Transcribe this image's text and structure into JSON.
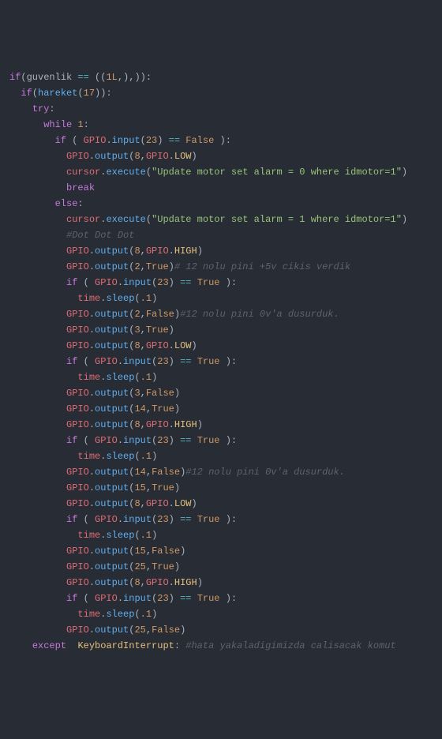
{
  "code": {
    "l01": {
      "guvenlik": "guvenlik",
      "if": "if",
      "eq": "==",
      "one": "1L",
      "colon": ":"
    },
    "l02": {
      "if": "if",
      "hareket": "hareket",
      "n": "17",
      "colon": ":"
    },
    "l03": {
      "try": "try",
      "colon": ":"
    },
    "l04": {
      "while": "while",
      "one": "1",
      "colon": ":"
    },
    "l05": {
      "if": "if",
      "gpio": "GPIO",
      "input": "input",
      "n": "23",
      "eq": "==",
      "false": "False",
      "colon": ":"
    },
    "l06": {
      "gpio": "GPIO",
      "output": "output",
      "n": "8",
      "gpio2": "GPIO",
      "low": "LOW"
    },
    "l07": {
      "cursor": "cursor",
      "execute": "execute",
      "str": "\"Update motor set alarm = 0 where idmotor=1\""
    },
    "l08": {
      "break": "break"
    },
    "l09": {
      "else": "else",
      "colon": ":"
    },
    "l10": {
      "cursor": "cursor",
      "execute": "execute",
      "str": "\"Update motor set alarm = 1 where idmotor=1\""
    },
    "l11": {
      "comment": "#Dot Dot Dot"
    },
    "l12": {
      "gpio": "GPIO",
      "output": "output",
      "n": "8",
      "gpio2": "GPIO",
      "high": "HIGH"
    },
    "l13": {
      "gpio": "GPIO",
      "output": "output",
      "n": "2",
      "true": "True",
      "comment": "# 12 nolu pini +5v cikis verdik"
    },
    "l14": {
      "if": "if",
      "gpio": "GPIO",
      "input": "input",
      "n": "23",
      "eq": "==",
      "true": "True",
      "colon": ":"
    },
    "l15": {
      "time": "time",
      "sleep": "sleep",
      "n": ".1"
    },
    "l16": {
      "gpio": "GPIO",
      "output": "output",
      "n": "2",
      "false": "False",
      "comment": "#12 nolu pini 0v'a dusurduk."
    },
    "l17": {
      "gpio": "GPIO",
      "output": "output",
      "n": "3",
      "true": "True"
    },
    "l18": {
      "gpio": "GPIO",
      "output": "output",
      "n": "8",
      "gpio2": "GPIO",
      "low": "LOW"
    },
    "l19": {
      "if": "if",
      "gpio": "GPIO",
      "input": "input",
      "n": "23",
      "eq": "==",
      "true": "True",
      "colon": ":"
    },
    "l20": {
      "time": "time",
      "sleep": "sleep",
      "n": ".1"
    },
    "l21": {
      "gpio": "GPIO",
      "output": "output",
      "n": "3",
      "false": "False"
    },
    "l22": {
      "gpio": "GPIO",
      "output": "output",
      "n": "14",
      "true": "True"
    },
    "l23": {
      "gpio": "GPIO",
      "output": "output",
      "n": "8",
      "gpio2": "GPIO",
      "high": "HIGH"
    },
    "l24": {
      "if": "if",
      "gpio": "GPIO",
      "input": "input",
      "n": "23",
      "eq": "==",
      "true": "True",
      "colon": ":"
    },
    "l25": {
      "time": "time",
      "sleep": "sleep",
      "n": ".1"
    },
    "l26": {
      "gpio": "GPIO",
      "output": "output",
      "n": "14",
      "false": "False",
      "comment": "#12 nolu pini 0v'a dusurduk."
    },
    "l27": {
      "gpio": "GPIO",
      "output": "output",
      "n": "15",
      "true": "True"
    },
    "l28": {
      "gpio": "GPIO",
      "output": "output",
      "n": "8",
      "gpio2": "GPIO",
      "low": "LOW"
    },
    "l29": {
      "if": "if",
      "gpio": "GPIO",
      "input": "input",
      "n": "23",
      "eq": "==",
      "true": "True",
      "colon": ":"
    },
    "l30": {
      "time": "time",
      "sleep": "sleep",
      "n": ".1"
    },
    "l31": {
      "gpio": "GPIO",
      "output": "output",
      "n": "15",
      "false": "False"
    },
    "l32": {
      "gpio": "GPIO",
      "output": "output",
      "n": "25",
      "true": "True"
    },
    "l33": {
      "gpio": "GPIO",
      "output": "output",
      "n": "8",
      "gpio2": "GPIO",
      "high": "HIGH"
    },
    "l34": {
      "if": "if",
      "gpio": "GPIO",
      "input": "input",
      "n": "23",
      "eq": "==",
      "true": "True",
      "colon": ":"
    },
    "l35": {
      "time": "time",
      "sleep": "sleep",
      "n": ".1"
    },
    "l36": {
      "gpio": "GPIO",
      "output": "output",
      "n": "25",
      "false": "False"
    },
    "l37": {
      "except": "except",
      "ki": "KeyboardInterrupt",
      "colon": ":",
      "comment": "#hata yakaladigimizda calisacak komut"
    }
  }
}
